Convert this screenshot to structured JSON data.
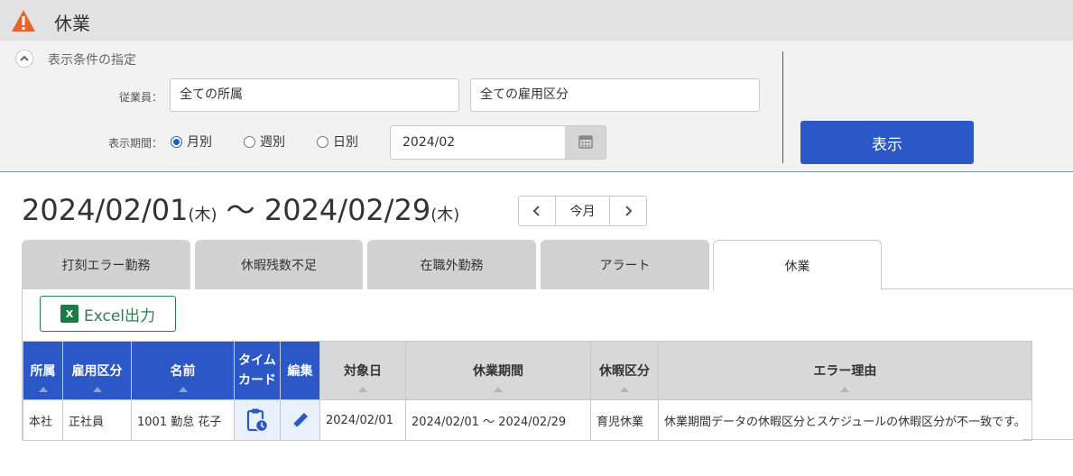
{
  "header": {
    "title": "休業",
    "icon": "warning-icon",
    "icon_color": "#e8632b"
  },
  "filter": {
    "section_title": "表示条件の指定",
    "employee_label": "従業員：",
    "department_value": "全ての所属",
    "employment_type_value": "全ての雇用区分",
    "period_label": "表示期間：",
    "radios": [
      {
        "label": "月別",
        "checked": true
      },
      {
        "label": "週別",
        "checked": false
      },
      {
        "label": "日別",
        "checked": false
      }
    ],
    "date_value": "2024/02",
    "show_button": "表示",
    "accent_color": "#2b58c6"
  },
  "range": {
    "start": "2024/02/01",
    "start_wd": "(木)",
    "sep": " ～ ",
    "end": "2024/02/29",
    "end_wd": "(木)",
    "today_button": "今月"
  },
  "tabs": [
    {
      "label": "打刻エラー勤務",
      "active": false
    },
    {
      "label": "休暇残数不足",
      "active": false
    },
    {
      "label": "在職外勤務",
      "active": false
    },
    {
      "label": "アラート",
      "active": false
    },
    {
      "label": "休業",
      "active": true
    }
  ],
  "excel_button": "Excel出力",
  "table": {
    "headers": [
      "所属",
      "雇用区分",
      "名前",
      "タイムカード",
      "編集",
      "対象日",
      "休業期間",
      "休暇区分",
      "エラー理由"
    ],
    "rows": [
      {
        "dept": "本社",
        "emp_type": "正社員",
        "name": "1001 勤怠 花子",
        "date": "2024/02/01",
        "period": "2024/02/01 ～ 2024/02/29",
        "leave_type": "育児休業",
        "error": "休業期間データの休暇区分とスケジュールの休暇区分が不一致です。"
      }
    ]
  }
}
